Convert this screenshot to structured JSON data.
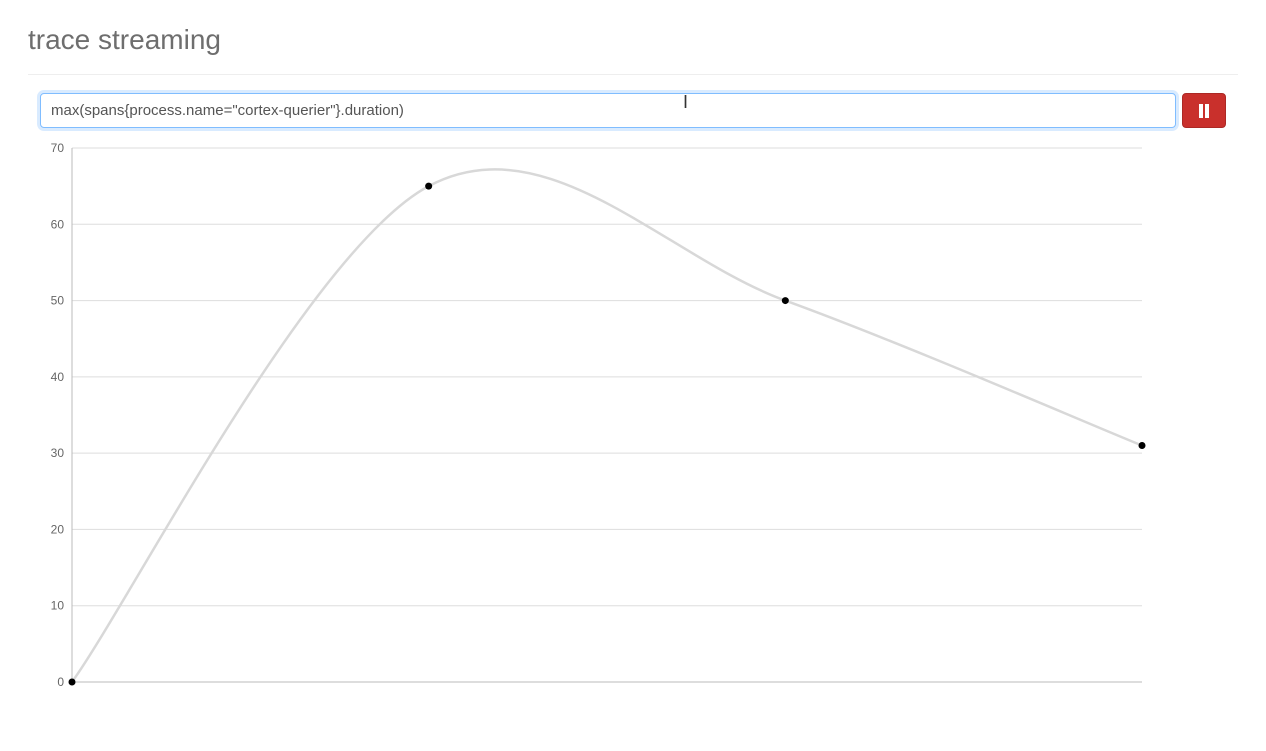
{
  "header": {
    "title": "trace streaming"
  },
  "toolbar": {
    "query_value": "max(spans{process.name=\"cortex-querier\"}.duration)",
    "pause_label": "Pause"
  },
  "colors": {
    "pause_button": "#c9302c",
    "curve": "#d8d8d8",
    "grid": "#dddddd"
  },
  "chart_data": {
    "type": "line",
    "title": "",
    "xlabel": "",
    "ylabel": "",
    "ylim": [
      0,
      70
    ],
    "y_ticks": [
      0,
      10,
      20,
      30,
      40,
      50,
      60,
      70
    ],
    "x": [
      0,
      1,
      2,
      3
    ],
    "values": [
      0,
      65,
      50,
      31
    ]
  }
}
